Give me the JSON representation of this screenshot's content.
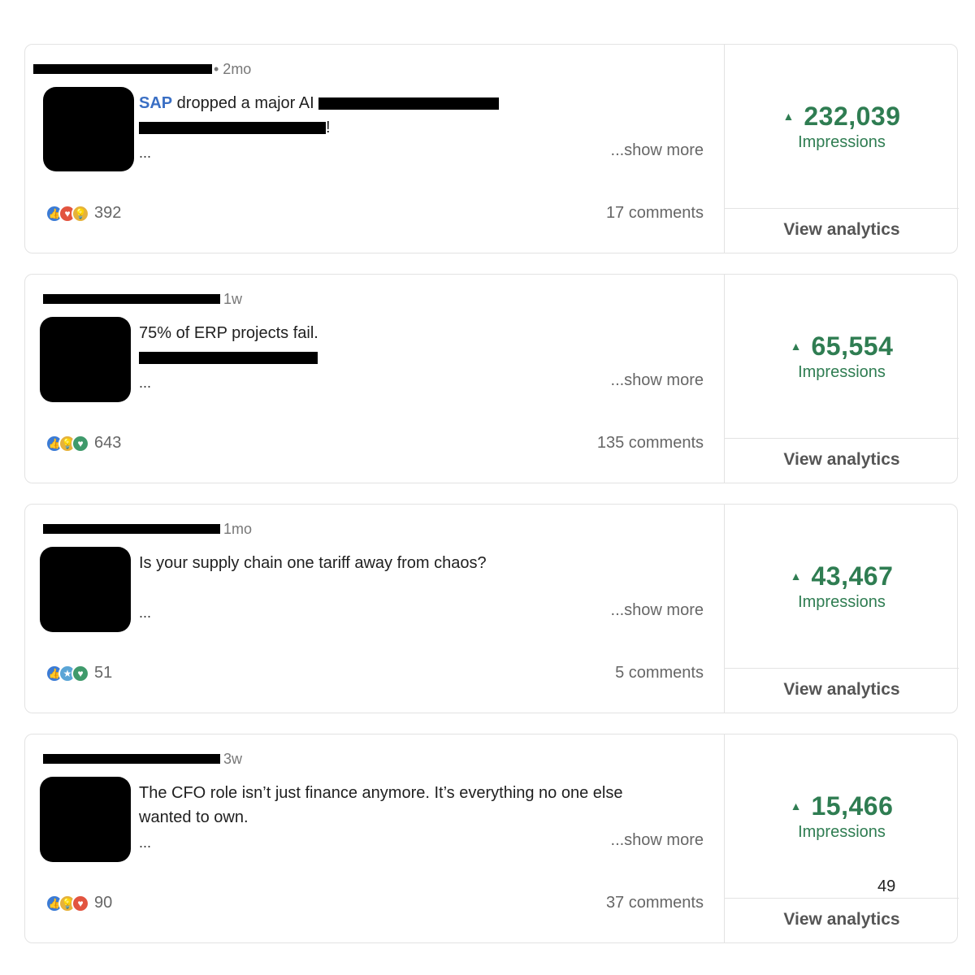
{
  "posts": [
    {
      "time": "• 2mo",
      "text_brand": "SAP",
      "text_line1": " dropped a major AI ",
      "text_line2_end": "!",
      "ellipsis": "...",
      "show_more": "...show more",
      "reactions": [
        "like-icon",
        "love-icon",
        "insightful-icon"
      ],
      "reaction_count": "392",
      "comments": "17 comments",
      "impressions": "232,039",
      "impressions_label": "Impressions",
      "view_analytics": "View analytics"
    },
    {
      "time": "1w",
      "text_line1": "75% of ERP projects fail.",
      "ellipsis": "...",
      "show_more": "...show more",
      "reactions": [
        "like-icon",
        "insightful-icon",
        "support-icon"
      ],
      "reaction_count": "643",
      "comments": "135 comments",
      "impressions": "65,554",
      "impressions_label": "Impressions",
      "view_analytics": "View analytics"
    },
    {
      "time": "1mo",
      "text_line1": "Is your supply chain one tariff away from chaos?",
      "ellipsis": "...",
      "show_more": "...show more",
      "reactions": [
        "like-icon",
        "celebrate-icon",
        "support-icon"
      ],
      "reaction_count": "51",
      "comments": "5 comments",
      "impressions": "43,467",
      "impressions_label": "Impressions",
      "view_analytics": "View analytics"
    },
    {
      "time": "3w",
      "text_line1": "The CFO role isn’t just finance anymore. It’s everything no one else",
      "text_line2": "wanted to own.",
      "ellipsis": "...",
      "show_more": "...show more",
      "reactions": [
        "like-icon",
        "insightful-icon",
        "love-icon"
      ],
      "reaction_count": "90",
      "comments": "37 comments",
      "impressions": "15,466",
      "impressions_label": "Impressions",
      "view_analytics": "View analytics"
    }
  ],
  "page_number": "49",
  "colors": {
    "impressions_green": "#2f7d52",
    "brand_blue": "#3a6fc4",
    "border": "#e3e3e3"
  }
}
